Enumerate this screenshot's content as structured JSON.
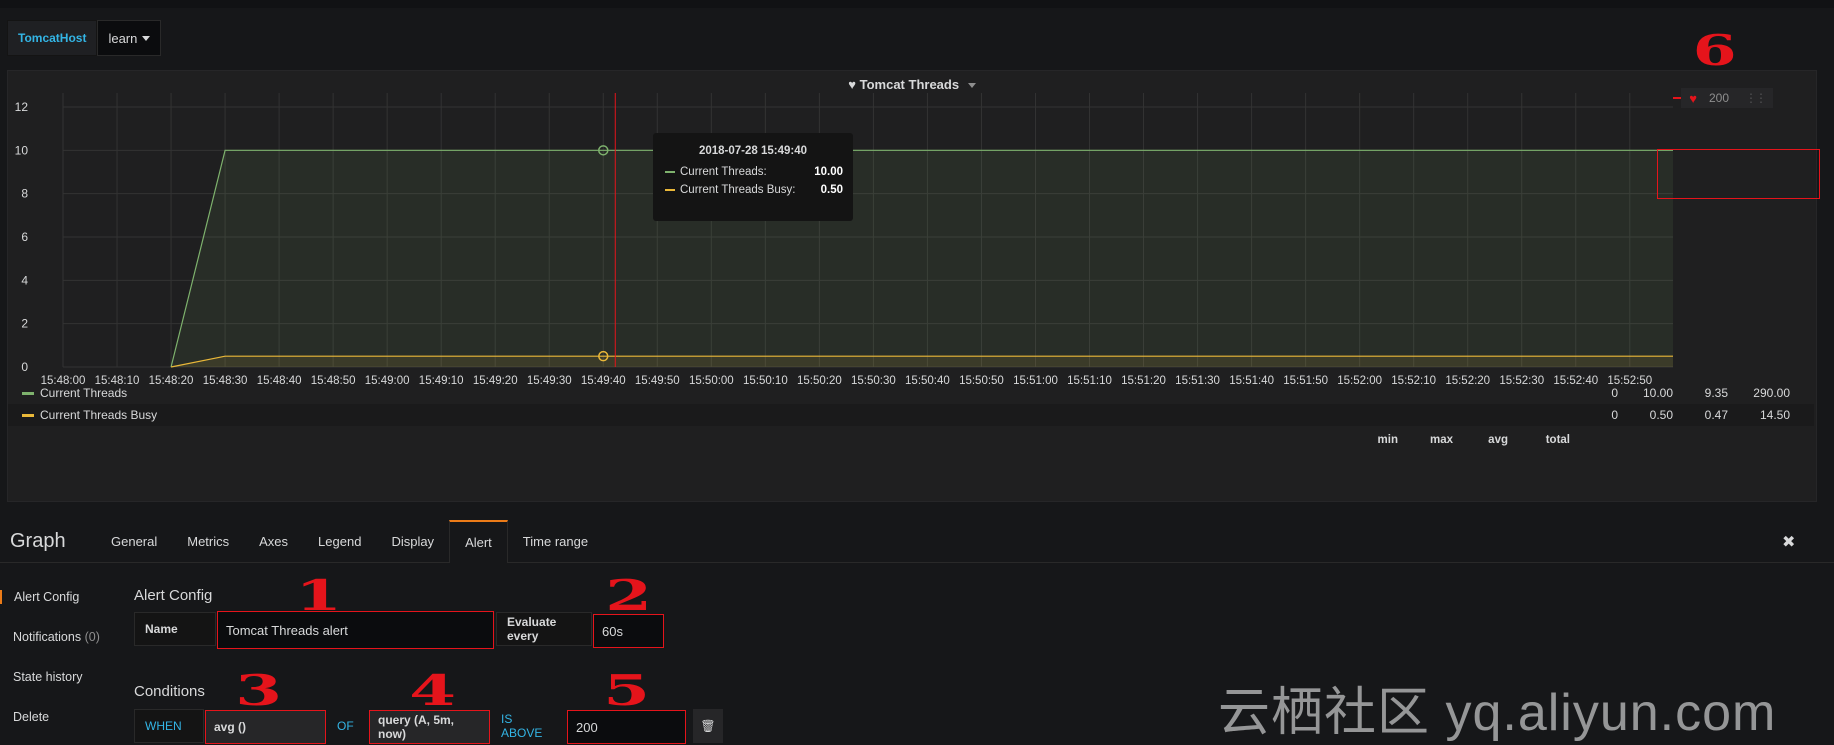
{
  "variables": {
    "label": "TomcatHost",
    "value": "learn"
  },
  "panel": {
    "title": "Tomcat Threads",
    "threshold_value": "200",
    "tooltip": {
      "time": "2018-07-28 15:49:40",
      "rows": [
        {
          "name": "Current Threads:",
          "value": "10.00",
          "color": "#7eb26d"
        },
        {
          "name": "Current Threads Busy:",
          "value": "0.50",
          "color": "#eab839"
        }
      ]
    },
    "legend": {
      "headers": [
        "min",
        "max",
        "avg",
        "total"
      ],
      "rows": [
        {
          "name": "Current Threads",
          "color": "#7eb26d",
          "min": "0",
          "max": "10.00",
          "avg": "9.35",
          "total": "290.00"
        },
        {
          "name": "Current Threads Busy",
          "color": "#eab839",
          "min": "0",
          "max": "0.50",
          "avg": "0.47",
          "total": "14.50"
        }
      ]
    }
  },
  "chart_data": {
    "type": "area",
    "title": "Tomcat Threads",
    "ylim": [
      0,
      12
    ],
    "yticks": [
      0,
      2,
      4,
      6,
      8,
      10,
      12
    ],
    "xticks": [
      "15:48:00",
      "15:48:10",
      "15:48:20",
      "15:48:30",
      "15:48:40",
      "15:48:50",
      "15:49:00",
      "15:49:10",
      "15:49:20",
      "15:49:30",
      "15:49:40",
      "15:49:50",
      "15:50:00",
      "15:50:10",
      "15:50:20",
      "15:50:30",
      "15:50:40",
      "15:50:50",
      "15:51:00",
      "15:51:10",
      "15:51:20",
      "15:51:30",
      "15:51:40",
      "15:51:50",
      "15:52:00",
      "15:52:10",
      "15:52:20",
      "15:52:30",
      "15:52:40",
      "15:52:50"
    ],
    "series": [
      {
        "name": "Current Threads",
        "color": "#7eb26d",
        "x": [
          "15:48:20",
          "15:48:30",
          "15:52:58"
        ],
        "values": [
          0,
          10,
          10
        ]
      },
      {
        "name": "Current Threads Busy",
        "color": "#eab839",
        "x": [
          "15:48:20",
          "15:48:30",
          "15:52:58"
        ],
        "values": [
          0,
          0.5,
          0.5
        ]
      }
    ],
    "hover_time": "15:49:40",
    "threshold": 200
  },
  "editor": {
    "title": "Graph",
    "tabs": [
      "General",
      "Metrics",
      "Axes",
      "Legend",
      "Display",
      "Alert",
      "Time range"
    ],
    "active_tab": "Alert",
    "close": "✖"
  },
  "side_nav": {
    "items": [
      {
        "label": "Alert Config",
        "count": ""
      },
      {
        "label": "Notifications",
        "count": "(0)"
      },
      {
        "label": "State history",
        "count": ""
      },
      {
        "label": "Delete",
        "count": ""
      }
    ]
  },
  "alert_config": {
    "section_title": "Alert Config",
    "name_label": "Name",
    "name_value": "Tomcat Threads alert",
    "evaluate_label": "Evaluate every",
    "evaluate_value": "60s"
  },
  "conditions": {
    "section_title": "Conditions",
    "when": "WHEN",
    "reducer": "avg ()",
    "of": "OF",
    "query": "query (A, 5m, now)",
    "is_above": "IS ABOVE",
    "threshold": "200"
  },
  "annotations": [
    "1",
    "2",
    "3",
    "4",
    "5",
    "6"
  ],
  "watermark": "云栖社区 yq.aliyun.com"
}
